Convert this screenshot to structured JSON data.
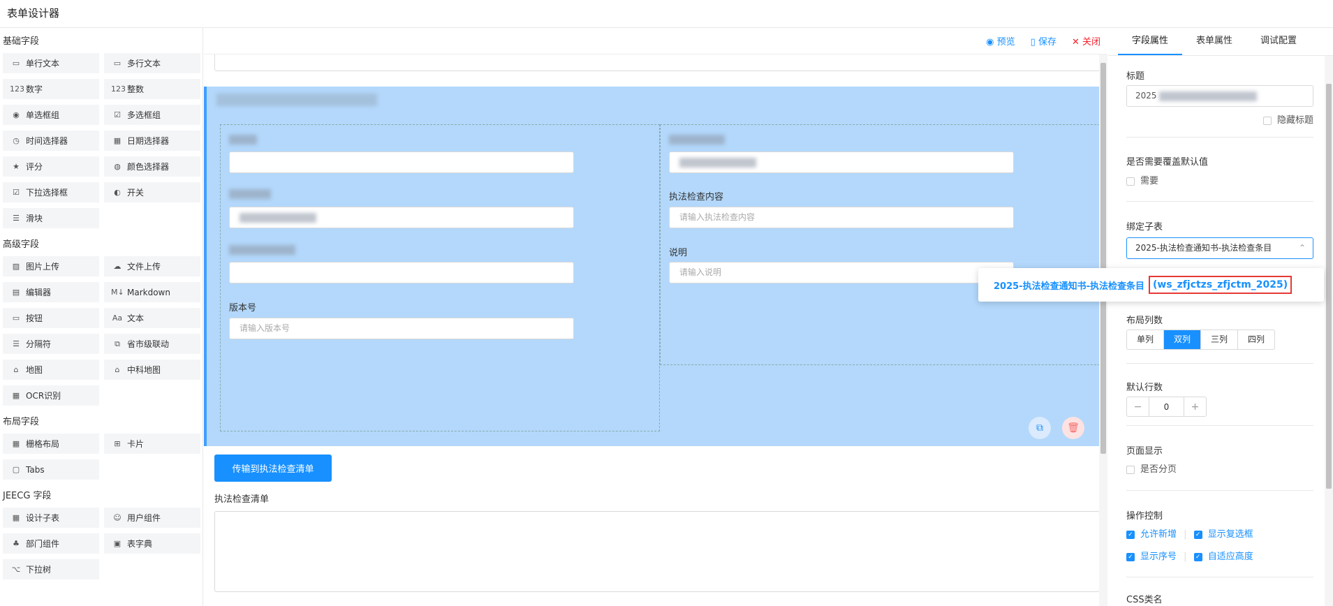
{
  "app": {
    "title": "表单设计器"
  },
  "left": {
    "basic": {
      "title": "基础字段",
      "items": [
        {
          "label": "单行文本",
          "icon": "▭"
        },
        {
          "label": "多行文本",
          "icon": "▭"
        },
        {
          "label": "数字",
          "icon": "123"
        },
        {
          "label": "整数",
          "icon": "123"
        },
        {
          "label": "单选框组",
          "icon": "◉"
        },
        {
          "label": "多选框组",
          "icon": "☑"
        },
        {
          "label": "时间选择器",
          "icon": "◷"
        },
        {
          "label": "日期选择器",
          "icon": "▦"
        },
        {
          "label": "评分",
          "icon": "★"
        },
        {
          "label": "颜色选择器",
          "icon": "◍"
        },
        {
          "label": "下拉选择框",
          "icon": "☑"
        },
        {
          "label": "开关",
          "icon": "◐"
        },
        {
          "label": "滑块",
          "icon": "☰"
        }
      ]
    },
    "advanced": {
      "title": "高级字段",
      "items": [
        {
          "label": "图片上传",
          "icon": "▨"
        },
        {
          "label": "文件上传",
          "icon": "☁"
        },
        {
          "label": "编辑器",
          "icon": "▤"
        },
        {
          "label": "Markdown",
          "icon": "M↓"
        },
        {
          "label": "按钮",
          "icon": "▭"
        },
        {
          "label": "文本",
          "icon": "Aa"
        },
        {
          "label": "分隔符",
          "icon": "☰"
        },
        {
          "label": "省市级联动",
          "icon": "⧉"
        },
        {
          "label": "地图",
          "icon": "⌂"
        },
        {
          "label": "中科地图",
          "icon": "⌂"
        },
        {
          "label": "OCR识别",
          "icon": "▦"
        }
      ]
    },
    "layout": {
      "title": "布局字段",
      "items": [
        {
          "label": "栅格布局",
          "icon": "▦"
        },
        {
          "label": "卡片",
          "icon": "⊞"
        },
        {
          "label": "Tabs",
          "icon": "▢"
        }
      ]
    },
    "jeecg": {
      "title": "JEECG 字段",
      "items": [
        {
          "label": "设计子表",
          "icon": "▦"
        },
        {
          "label": "用户组件",
          "icon": "☺"
        },
        {
          "label": "部门组件",
          "icon": "♣"
        },
        {
          "label": "表字典",
          "icon": "▣"
        },
        {
          "label": "下拉树",
          "icon": "⌥"
        }
      ]
    }
  },
  "toolbar": {
    "preview": "预览",
    "save": "保存",
    "close": "关闭"
  },
  "canvas": {
    "col2": {
      "label2": "执法检查内容",
      "ph2": "请输入执法检查内容",
      "label3": "说明",
      "ph3": "请输入说明"
    },
    "col1": {
      "label4": "版本号",
      "ph4": "请输入版本号"
    },
    "transfer_btn": "传输到执法检查清单",
    "list_label": "执法检查清单"
  },
  "right": {
    "tabs": [
      "字段属性",
      "表单属性",
      "调试配置"
    ],
    "title_label": "标题",
    "title_value": "2025",
    "hide_title": "隐藏标题",
    "override_label": "是否需要覆盖默认值",
    "override_opt": "需要",
    "bind_label": "绑定子表",
    "bind_value": "2025-执法检查通知书-执法检查条目",
    "cols_label": "布局列数",
    "cols": [
      "单列",
      "双列",
      "三列",
      "四列"
    ],
    "rows_label": "默认行数",
    "rows_value": "0",
    "page_label": "页面显示",
    "page_opt": "是否分页",
    "op_label": "操作控制",
    "op1": "允许新增",
    "op2": "显示复选框",
    "op3": "显示序号",
    "op4": "自适应高度",
    "css_label": "CSS类名"
  },
  "popup": {
    "name": "2025-执法检查通知书-执法检查条目",
    "code": "(ws_zfjctzs_zfjctm_2025)"
  }
}
